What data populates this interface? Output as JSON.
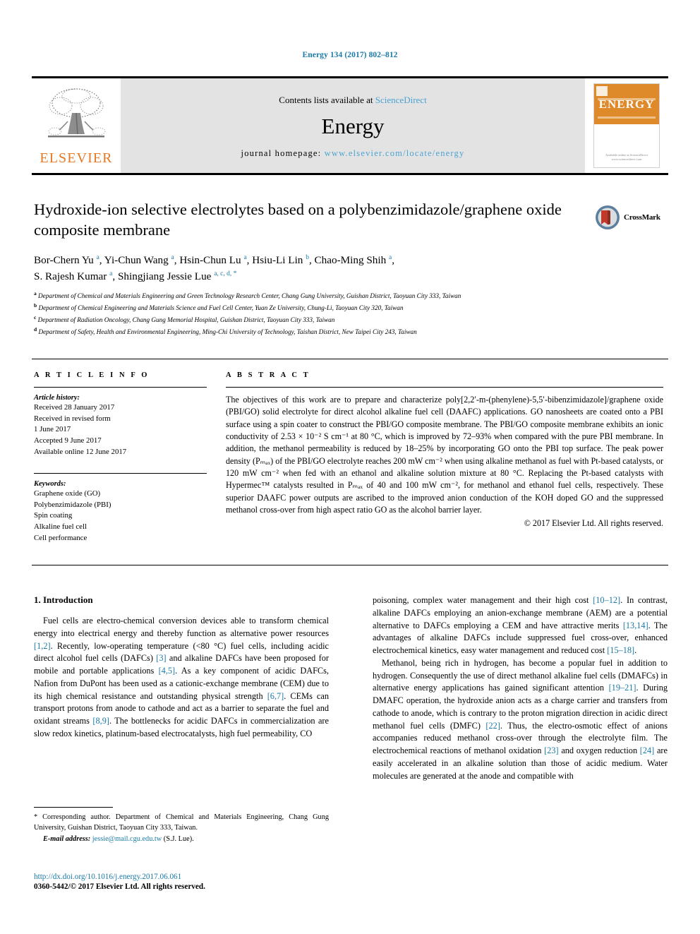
{
  "running_head": "Energy 134 (2017) 802–812",
  "masthead": {
    "publisher_name": "ELSEVIER",
    "contents_prefix": "Contents lists available at ",
    "contents_link": "ScienceDirect",
    "journal_title": "Energy",
    "homepage_prefix": "journal homepage: ",
    "homepage_url": "www.elsevier.com/locate/energy",
    "cover_title": "ENERGY",
    "cover_footer": "Available online at\nScienceDirect\nwww.sciencedirect.com"
  },
  "article": {
    "title": "Hydroxide-ion selective electrolytes based on a polybenzimidazole/graphene oxide composite membrane",
    "crossmark_label": "CrossMark",
    "authors_line1": "Bor-Chern Yu a, Yi-Chun Wang a, Hsin-Chun Lu a, Hsiu-Li Lin b, Chao-Ming Shih a,",
    "authors_line2": "S. Rajesh Kumar a, Shingjiang Jessie Lue a, c, d, *",
    "authors": [
      {
        "name": "Bor-Chern Yu",
        "marks": "a"
      },
      {
        "name": "Yi-Chun Wang",
        "marks": "a"
      },
      {
        "name": "Hsin-Chun Lu",
        "marks": "a"
      },
      {
        "name": "Hsiu-Li Lin",
        "marks": "b"
      },
      {
        "name": "Chao-Ming Shih",
        "marks": "a"
      },
      {
        "name": "S. Rajesh Kumar",
        "marks": "a"
      },
      {
        "name": "Shingjiang Jessie Lue",
        "marks": "a, c, d, *"
      }
    ],
    "affiliations": [
      {
        "mark": "a",
        "text": "Department of Chemical and Materials Engineering and Green Technology Research Center, Chang Gung University, Guishan District, Taoyuan City 333, Taiwan"
      },
      {
        "mark": "b",
        "text": "Department of Chemical Engineering and Materials Science and Fuel Cell Center, Yuan Ze University, Chung-Li, Taoyuan City 320, Taiwan"
      },
      {
        "mark": "c",
        "text": "Department of Radiation Oncology, Chang Gung Memorial Hospital, Guishan District, Taoyuan City 333, Taiwan"
      },
      {
        "mark": "d",
        "text": "Department of Safety, Health and Environmental Engineering, Ming-Chi University of Technology, Taishan District, New Taipei City 243, Taiwan"
      }
    ]
  },
  "article_info": {
    "heading": "A R T I C L E  I N F O",
    "history_label": "Article history:",
    "history": [
      "Received 28 January 2017",
      "Received in revised form",
      "1 June 2017",
      "Accepted 9 June 2017",
      "Available online 12 June 2017"
    ],
    "keywords_label": "Keywords:",
    "keywords": [
      "Graphene oxide (GO)",
      "Polybenzimidazole (PBI)",
      "Spin coating",
      "Alkaline fuel cell",
      "Cell performance"
    ]
  },
  "abstract": {
    "heading": "A B S T R A C T",
    "paragraphs": [
      "The objectives of this work are to prepare and characterize poly[2,2′-m-(phenylene)-5,5′-bibenzimidazole]/graphene oxide (PBI/GO) solid electrolyte for direct alcohol alkaline fuel cell (DAAFC) applications. GO nanosheets are coated onto a PBI surface using a spin coater to construct the PBI/GO composite membrane. The PBI/GO composite membrane exhibits an ionic conductivity of 2.53 × 10⁻² S cm⁻¹ at 80 °C, which is improved by 72–93% when compared with the pure PBI membrane. In addition, the methanol permeability is reduced by 18–25% by incorporating GO onto the PBI top surface. The peak power density (Pₘₐₓ) of the PBI/GO electrolyte reaches 200 mW cm⁻² when using alkaline methanol as fuel with Pt-based catalysts, or 120 mW cm⁻² when fed with an ethanol and alkaline solution mixture at 80 °C. Replacing the Pt-based catalysts with Hypermec™ catalysts resulted in Pₘₐₓ of 40 and 100 mW cm⁻², for methanol and ethanol fuel cells, respectively. These superior DAAFC power outputs are ascribed to the improved anion conduction of the KOH doped GO and the suppressed methanol cross-over from high aspect ratio GO as the alcohol barrier layer."
    ],
    "copyright": "© 2017 Elsevier Ltd. All rights reserved."
  },
  "body": {
    "section_heading": "1. Introduction",
    "left_paragraphs": [
      "Fuel cells are electro-chemical conversion devices able to transform chemical energy into electrical energy and thereby function as alternative power resources [1,2]. Recently, low-operating temperature (<80 °C) fuel cells, including acidic direct alcohol fuel cells (DAFCs) [3] and alkaline DAFCs have been proposed for mobile and portable applications [4,5]. As a key component of acidic DAFCs, Nafion from DuPont has been used as a cationic-exchange membrane (CEM) due to its high chemical resistance and outstanding physical strength [6,7]. CEMs can transport protons from anode to cathode and act as a barrier to separate the fuel and oxidant streams [8,9]. The bottlenecks for acidic DAFCs in commercialization are slow redox kinetics, platinum-based electrocatalysts, high fuel permeability, CO"
    ],
    "right_paragraphs": [
      "poisoning, complex water management and their high cost [10–12]. In contrast, alkaline DAFCs employing an anion-exchange membrane (AEM) are a potential alternative to DAFCs employing a CEM and have attractive merits [13,14]. The advantages of alkaline DAFCs include suppressed fuel cross-over, enhanced electrochemical kinetics, easy water management and reduced cost [15–18].",
      "Methanol, being rich in hydrogen, has become a popular fuel in addition to hydrogen. Consequently the use of direct methanol alkaline fuel cells (DMAFCs) in alternative energy applications has gained significant attention [19–21]. During DMAFC operation, the hydroxide anion acts as a charge carrier and transfers from cathode to anode, which is contrary to the proton migration direction in acidic direct methanol fuel cells (DMFC) [22]. Thus, the electro-osmotic effect of anions accompanies reduced methanol cross-over through the electrolyte film. The electrochemical reactions of methanol oxidation [23] and oxygen reduction [24] are easily accelerated in an alkaline solution than those of acidic medium. Water molecules are generated at the anode and compatible with"
    ]
  },
  "footnotes": {
    "corresponding": "* Corresponding author. Department of Chemical and Materials Engineering, Chang Gung University, Guishan District, Taoyuan City 333, Taiwan.",
    "email_label": "E-mail address:",
    "email": "jessie@mail.cgu.edu.tw",
    "email_suffix": "(S.J. Lue).",
    "doi": "http://dx.doi.org/10.1016/j.energy.2017.06.061",
    "issn": "0360-5442/© 2017 Elsevier Ltd. All rights reserved."
  },
  "colors": {
    "link": "#1a7aa8",
    "science_direct": "#4ba3d3",
    "elsevier_orange": "#E87722",
    "band_gray": "#e3e3e3"
  }
}
